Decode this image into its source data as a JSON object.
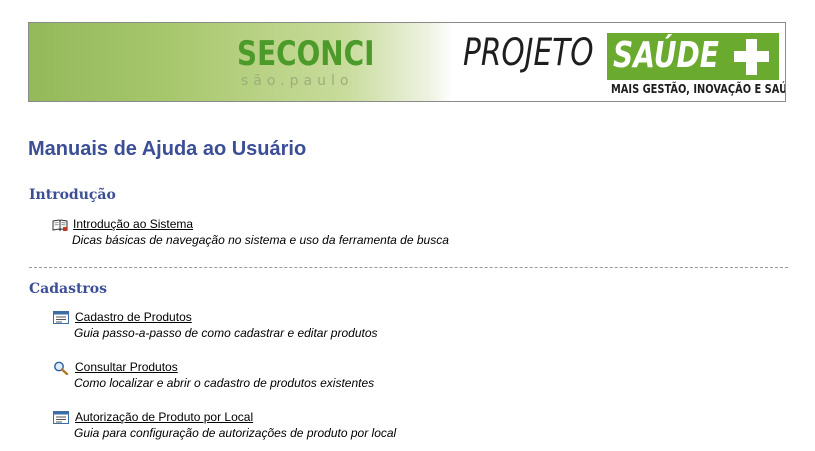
{
  "banner": {
    "seconci_name": "SECONCI",
    "seconci_city": "são.paulo",
    "projeto": "PROJETO",
    "saude": "SAÚDE",
    "tagline": "MAIS GESTÃO, INOVAÇÃO E SAÚDE",
    "colors": {
      "green": "#6aaa2e",
      "seconci_green": "#4c9a2a",
      "text_dark": "#1e1e1e"
    }
  },
  "page_title": "Manuais de Ajuda ao Usuário",
  "sections": [
    {
      "title": "Introdução",
      "items": [
        {
          "icon": "open-book-icon",
          "label": "Introdução ao Sistema",
          "description": "Dicas básicas de navegação no sistema e uso da ferramenta de busca"
        }
      ]
    },
    {
      "title": "Cadastros",
      "items": [
        {
          "icon": "form-window-icon",
          "label": "Cadastro de Produtos",
          "description": "Guia passo-a-passo de como cadastrar e editar produtos"
        },
        {
          "icon": "magnifier-icon",
          "label": "Consultar Produtos",
          "description": "Como localizar e abrir o cadastro de produtos existentes"
        },
        {
          "icon": "form-window-icon",
          "label": "Autorização de Produto por Local",
          "description": "Guia para configuração de autorizações de produto por local"
        }
      ]
    }
  ],
  "colors": {
    "title_blue": "#3b4e96",
    "divider": "#9a9a9a"
  }
}
